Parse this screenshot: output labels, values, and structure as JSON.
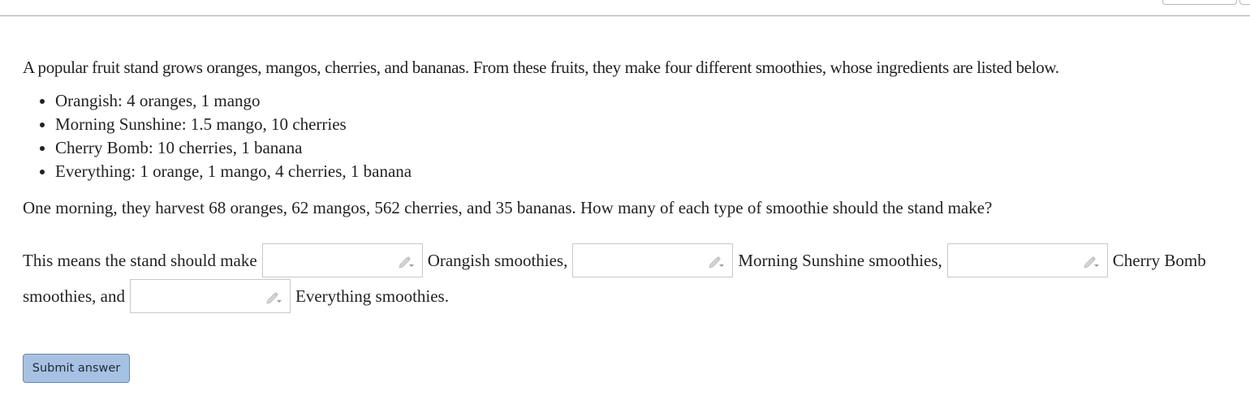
{
  "problem": {
    "intro": "A popular fruit stand grows oranges, mangos, cherries, and bananas. From these fruits, they make four different smoothies, whose ingredients are listed below.",
    "recipes": [
      "Orangish: 4 oranges, 1 mango",
      "Morning Sunshine: 1.5 mango, 10 cherries",
      "Cherry Bomb: 10 cherries, 1 banana",
      "Everything: 1 orange, 1 mango, 4 cherries, 1 banana"
    ],
    "question": "One morning, they harvest 68 oranges, 62 mangos, 562 cherries, and 35 bananas. How many of each type of smoothie should the stand make?"
  },
  "answer": {
    "prefix": "This means the stand should make",
    "after_1": "Orangish smoothies,",
    "after_2": "Morning Sunshine smoothies,",
    "after_3": "Cherry Bomb",
    "line2_prefix": "smoothies, and",
    "after_4": "Everything smoothies.",
    "inputs": [
      {
        "value": ""
      },
      {
        "value": ""
      },
      {
        "value": ""
      },
      {
        "value": ""
      }
    ],
    "input_icon": "pencil-dropdown-icon"
  },
  "actions": {
    "submit_label": "Submit answer"
  },
  "colors": {
    "submit_bg": "#a7c1e2",
    "submit_border": "#6f87a8",
    "rule": "#a8a8a8"
  }
}
